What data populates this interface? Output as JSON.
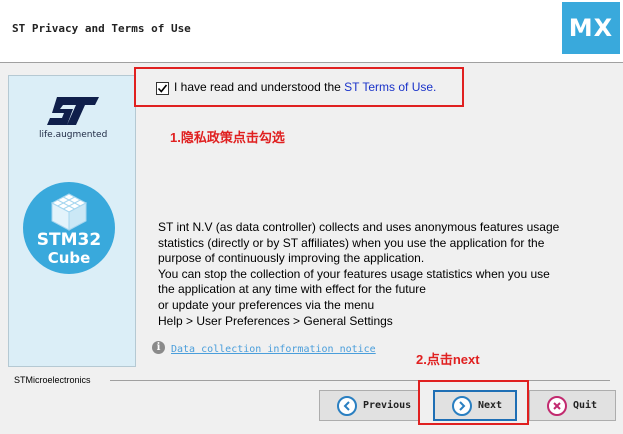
{
  "window": {
    "title": "ST Privacy and Terms of Use",
    "app_badge": "MX"
  },
  "branding": {
    "tagline": "life.augmented",
    "cube_line1": "STM32",
    "cube_line2": "Cube"
  },
  "consent": {
    "checked": true,
    "label": "I have read and understood the ",
    "link_text": "ST Terms of Use."
  },
  "annotations": {
    "step1": "1.隐私政策点击勾选",
    "step2": "2.点击next",
    "highlight_color": "#e02020"
  },
  "info": {
    "lines": [
      "ST int N.V (as data controller) collects and uses anonymous features usage",
      "statistics (directly or by ST affiliates) when you use the application for the",
      "purpose of continuously improving the application.",
      "You can stop the collection of your features usage statistics when you use",
      "the application at any time with effect for the future",
      "or update your preferences via the menu",
      "Help > User Preferences > General Settings"
    ],
    "notice_link": "Data collection information notice"
  },
  "footer": {
    "company": "STMicroelectronics"
  },
  "buttons": {
    "previous": "Previous",
    "next": "Next",
    "quit": "Quit"
  },
  "icons": {
    "info": "info-icon",
    "previous": "arrow-left-circle-icon",
    "next": "arrow-right-circle-icon",
    "quit": "close-circle-icon"
  },
  "colors": {
    "accent": "#39a9dc",
    "link": "#1a33c9"
  }
}
